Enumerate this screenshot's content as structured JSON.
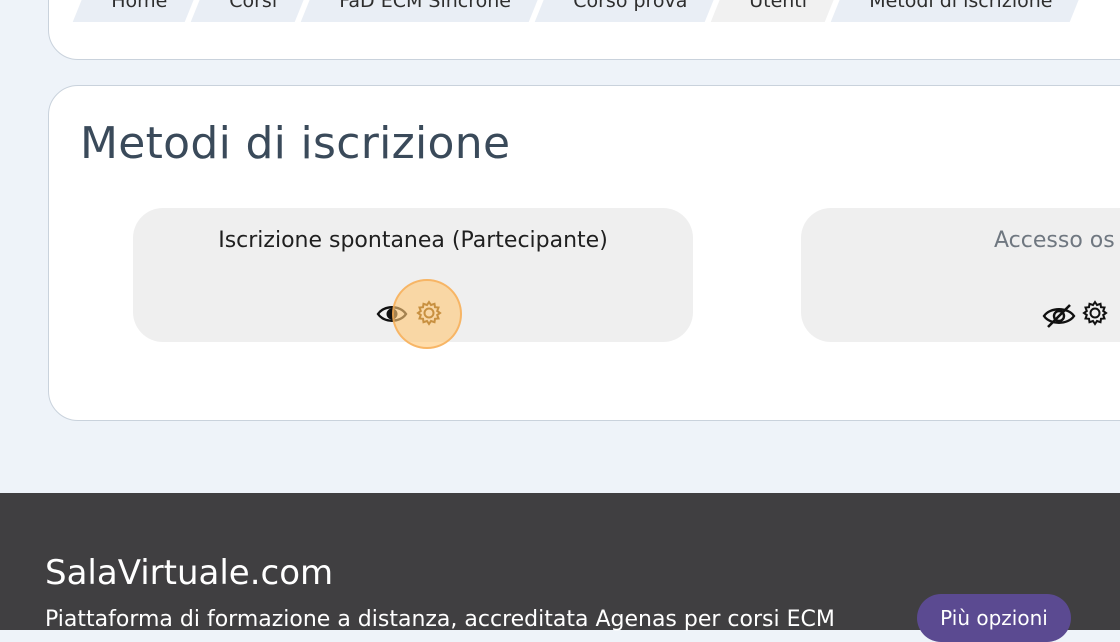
{
  "breadcrumb": [
    "Home",
    "Corsi",
    "FaD ECM Sincrone",
    "Corso prova",
    "Utenti",
    "Metodi di iscrizione"
  ],
  "page": {
    "title": "Metodi di iscrizione"
  },
  "methods": [
    {
      "name": "Iscrizione spontanea (Partecipante)",
      "icons": [
        "eye-icon",
        "gear-icon"
      ]
    },
    {
      "name": "Accesso os",
      "icons": [
        "eye-off-icon",
        "gear-icon"
      ]
    }
  ],
  "footer": {
    "brand": "SalaVirtuale.com",
    "tagline": "Piattaforma di formazione a distanza, accreditata Agenas per corsi ECM",
    "more_button": "Più opzioni"
  },
  "colors": {
    "accent": "#5b4a91",
    "footer_bg": "#403f41",
    "click_highlight": "#ffc878"
  }
}
